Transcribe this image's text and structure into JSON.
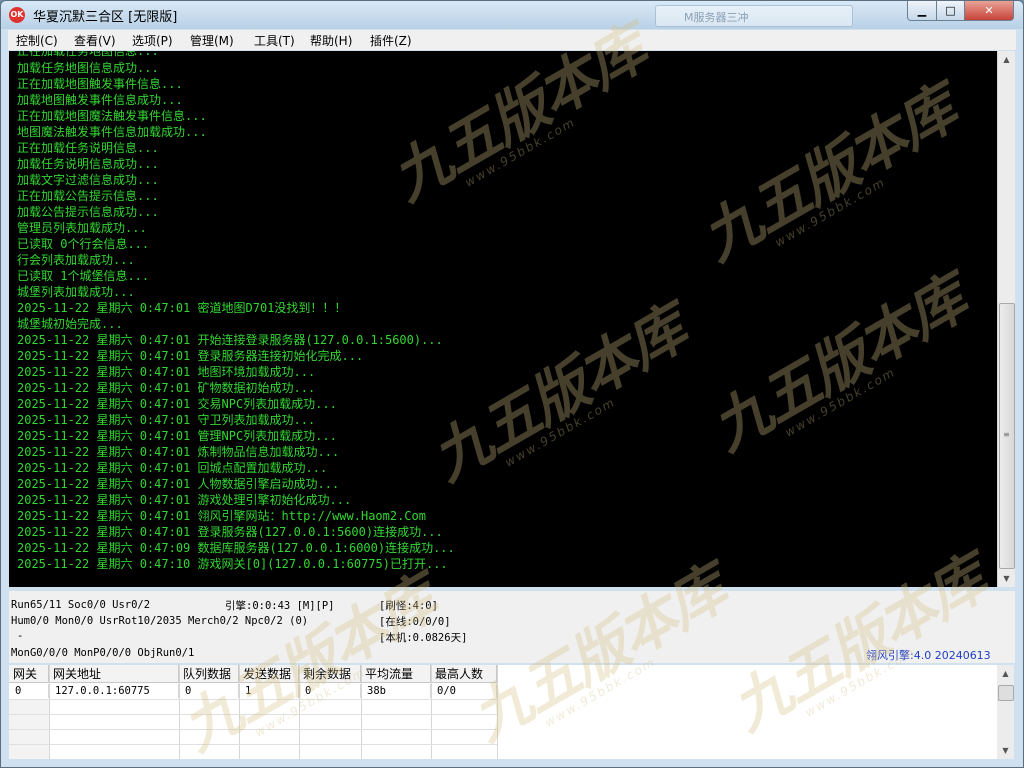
{
  "window": {
    "title": "华夏沉默三合区 [无限版]",
    "app_icon": "OK",
    "ghost_tab": "M服务器三冲",
    "min_glyph": "▁",
    "max_glyph": "□",
    "close_glyph": "✕"
  },
  "menu": [
    "控制(C)",
    "查看(V)",
    "选项(P)",
    "管理(M)",
    "工具(T)",
    "帮助(H)",
    "插件(Z)"
  ],
  "log": [
    "正在加载任务地图信息...",
    "加载任务地图信息成功...",
    "正在加载地图触发事件信息...",
    "加载地图触发事件信息成功...",
    "正在加载地图魔法触发事件信息...",
    "地图魔法触发事件信息加载成功...",
    "正在加载任务说明信息...",
    "加载任务说明信息成功...",
    "加载文字过滤信息成功...",
    "正在加载公告提示信息...",
    "加载公告提示信息成功...",
    "管理员列表加载成功...",
    "已读取 0个行会信息...",
    "行会列表加载成功...",
    "已读取 1个城堡信息...",
    "城堡列表加载成功...",
    "2025-11-22 星期六 0:47:01 密道地图D701没找到！！！",
    "城堡城初始完成...",
    "2025-11-22 星期六 0:47:01 开始连接登录服务器(127.0.0.1:5600)...",
    "2025-11-22 星期六 0:47:01 登录服务器连接初始化完成...",
    "2025-11-22 星期六 0:47:01 地图环境加载成功...",
    "2025-11-22 星期六 0:47:01 矿物数据初始成功...",
    "2025-11-22 星期六 0:47:01 交易NPC列表加载成功...",
    "2025-11-22 星期六 0:47:01 守卫列表加载成功...",
    "2025-11-22 星期六 0:47:01 管理NPC列表加载成功...",
    "2025-11-22 星期六 0:47:01 炼制物品信息加载成功...",
    "2025-11-22 星期六 0:47:01 回城点配置加载成功...",
    "2025-11-22 星期六 0:47:01 人物数据引擎启动成功...",
    "2025-11-22 星期六 0:47:01 游戏处理引擎初始化成功...",
    "2025-11-22 星期六 0:47:01 翎风引擎网站：http://www.Haom2.Com",
    "2025-11-22 星期六 0:47:01 登录服务器(127.0.0.1:5600)连接成功...",
    "2025-11-22 星期六 0:47:09 数据库服务器(127.0.0.1:6000)连接成功...",
    "2025-11-22 星期六 0:47:10 游戏网关[0](127.0.0.1:60775)已打开..."
  ],
  "status": {
    "run": "Run65/11 Soc0/0 Usr0/2",
    "engine": "引擎:0:0:43 [M][P]",
    "refresh": "[刷怪:4:0]",
    "hum": "Hum0/0 Mon0/0 UsrRot10/2035 Merch0/2 Npc0/2 (0)",
    "online": "[在线:0/0/0]",
    "dash": "-",
    "local": "[本机:0.0826天]",
    "mon": "MonG0/0/0 MonP0/0/0 ObjRun0/1",
    "version": "翎风引擎:4.0 20240613"
  },
  "grid": {
    "headers": [
      "网关",
      "网关地址",
      "队列数据",
      "发送数据",
      "剩余数据",
      "平均流量",
      "最高人数"
    ],
    "rows": [
      [
        "0",
        "127.0.0.1:60775",
        "0",
        "1",
        "0",
        "38b",
        "0/0"
      ]
    ]
  },
  "watermark": {
    "big": "九五版本库",
    "small": "www.95bbk.com"
  },
  "colors": {
    "log_text": "#33d633",
    "console_bg": "#000000",
    "version_text": "#1f3fc4"
  }
}
